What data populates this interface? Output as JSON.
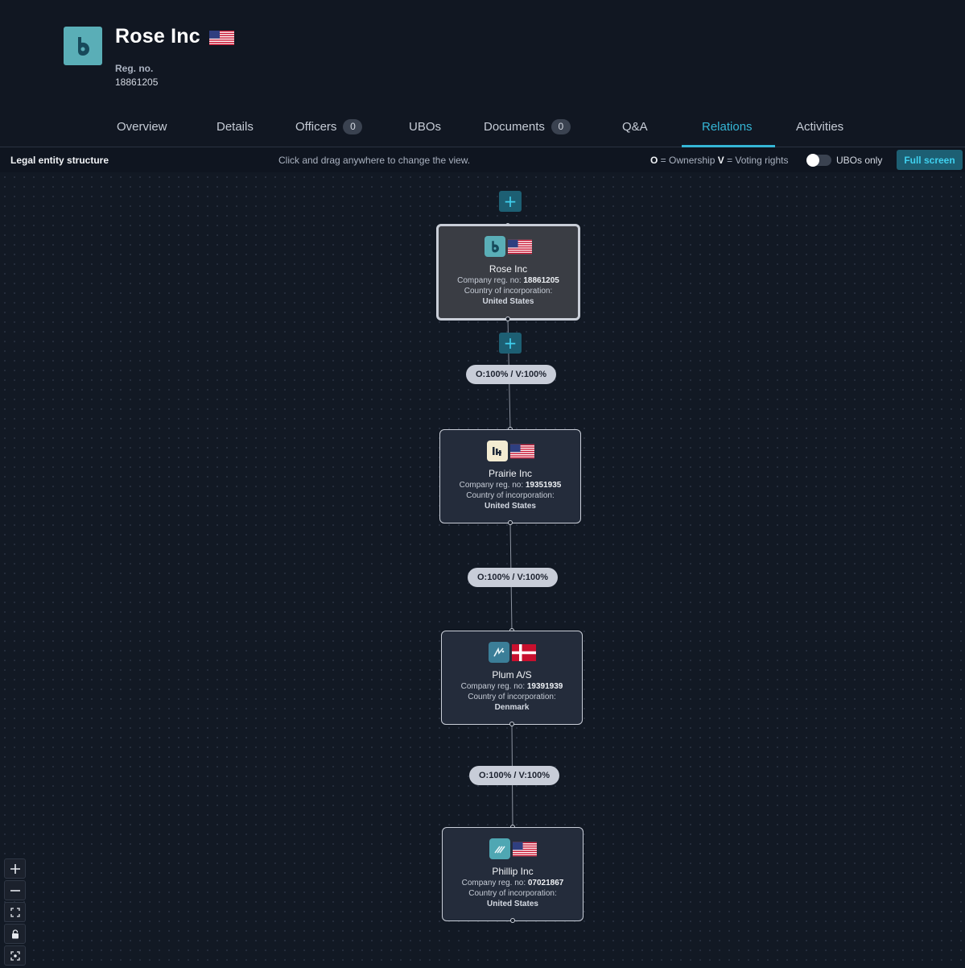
{
  "company": {
    "name": "Rose Inc",
    "reg_label": "Reg. no.",
    "reg_number": "18861205",
    "country_flag": "flag-us-icon"
  },
  "tabs": [
    {
      "label": "Overview"
    },
    {
      "label": "Details"
    },
    {
      "label": "Officers",
      "badge": "0"
    },
    {
      "label": "UBOs"
    },
    {
      "label": "Documents",
      "badge": "0"
    },
    {
      "label": "Q&A"
    },
    {
      "label": "Relations",
      "active": true
    },
    {
      "label": "Activities"
    }
  ],
  "toolbar": {
    "title": "Legal entity structure",
    "hint": "Click and drag anywhere to change the view.",
    "legend_o_key": "O",
    "legend_o_text": " = Ownership ",
    "legend_v_key": "V",
    "legend_v_text": " = Voting rights",
    "toggle_label": "UBOs only",
    "toggle_on": false,
    "fullscreen_label": "Full screen"
  },
  "graph": {
    "add_label": "+",
    "reg_prefix": "Company reg. no: ",
    "country_label": "Country of incorporation:",
    "nodes": [
      {
        "name": "Rose Inc",
        "reg": "18861205",
        "country": "United States",
        "flag": "flag-us-icon",
        "logo": "rose-logo-icon",
        "selected": true
      },
      {
        "name": "Prairie Inc",
        "reg": "19351935",
        "country": "United States",
        "flag": "flag-us-icon",
        "logo": "prairie-logo-icon"
      },
      {
        "name": "Plum A/S",
        "reg": "19391939",
        "country": "Denmark",
        "flag": "flag-dk-icon",
        "logo": "plum-logo-icon"
      },
      {
        "name": "Phillip Inc",
        "reg": "07021867",
        "country": "United States",
        "flag": "flag-us-icon",
        "logo": "phillip-logo-icon"
      }
    ],
    "edges": [
      {
        "label": "O:100% / V:100%"
      },
      {
        "label": "O:100% / V:100%"
      },
      {
        "label": "O:100% / V:100%"
      }
    ]
  },
  "controls": [
    {
      "icon": "zoom-in-icon"
    },
    {
      "icon": "zoom-out-icon"
    },
    {
      "icon": "fit-view-icon"
    },
    {
      "icon": "lock-icon"
    },
    {
      "icon": "focus-icon"
    }
  ],
  "colors": {
    "accent": "#35b6d6",
    "button_bg": "#1d5f73",
    "background": "#0f1520"
  }
}
